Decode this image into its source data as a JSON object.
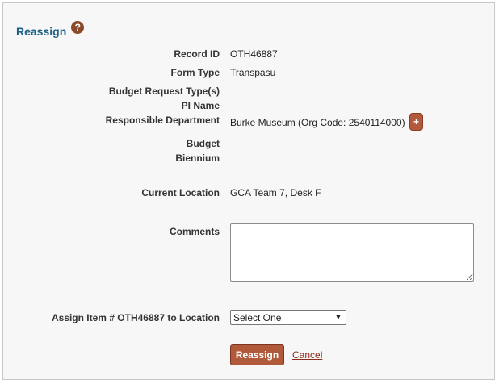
{
  "header": {
    "title": "Reassign",
    "help_icon": "question-mark-icon",
    "help_glyph": "?"
  },
  "fields": {
    "record_id": {
      "label": "Record ID",
      "value": "OTH46887"
    },
    "form_type": {
      "label": "Form Type",
      "value": "Transpasu"
    },
    "budget_request_types": {
      "label": "Budget Request Type(s)",
      "value": ""
    },
    "pi_name": {
      "label": "PI Name",
      "value": ""
    },
    "responsible_department": {
      "label": "Responsible Department",
      "value": "Burke Museum (Org Code: 2540114000)",
      "action_glyph": "+"
    },
    "budget": {
      "label": "Budget",
      "value": ""
    },
    "biennium": {
      "label": "Biennium",
      "value": ""
    },
    "current_location": {
      "label": "Current Location",
      "value": "GCA Team 7, Desk F"
    },
    "comments": {
      "label": "Comments",
      "value": ""
    }
  },
  "assign": {
    "label": "Assign Item # OTH46887 to Location",
    "selected": "Select One",
    "chevron_glyph": "▼"
  },
  "actions": {
    "reassign_label": "Reassign",
    "cancel_label": "Cancel"
  },
  "colors": {
    "title": "#1f5f86",
    "primary_button": "#b15a3b",
    "link": "#8a2b1a",
    "help_icon": "#8a4a2a"
  }
}
